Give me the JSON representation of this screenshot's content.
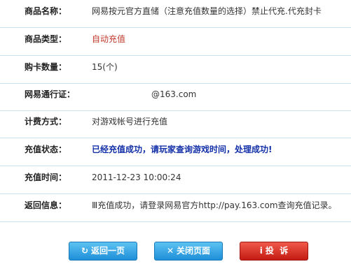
{
  "rows": [
    {
      "label": "商品名称：",
      "value": "网易按元官方直储（注意充值数量的选择）禁止代充.代充封卡"
    },
    {
      "label": "商品类型：",
      "value": "自动充值"
    },
    {
      "label": "购卡数量：",
      "value": "15(个)"
    },
    {
      "label": "网易通行证：",
      "value": "@163.com"
    },
    {
      "label": "计费方式：",
      "value": "对游戏帐号进行充值"
    },
    {
      "label": "充值状态：",
      "value": "已经充值成功，请玩家查询游戏时间，处理成功!"
    },
    {
      "label": "充值时间：",
      "value": "2011-12-23 10:00:24"
    },
    {
      "label": "返回信息：",
      "value": "Ⅲ充值成功，请登录网易官方http://pay.163.com查询充值记录。"
    }
  ],
  "buttons": {
    "back": {
      "label": "返回一页",
      "icon": "back-arrow-icon"
    },
    "close": {
      "label": "关闭页面",
      "icon": "close-x-icon"
    },
    "complaint": {
      "label": "投  诉",
      "icon": "exclamation-icon"
    }
  },
  "colors": {
    "red_value": "#c0392b",
    "status_blue": "#1330a8",
    "divider": "#c9e3ee"
  }
}
